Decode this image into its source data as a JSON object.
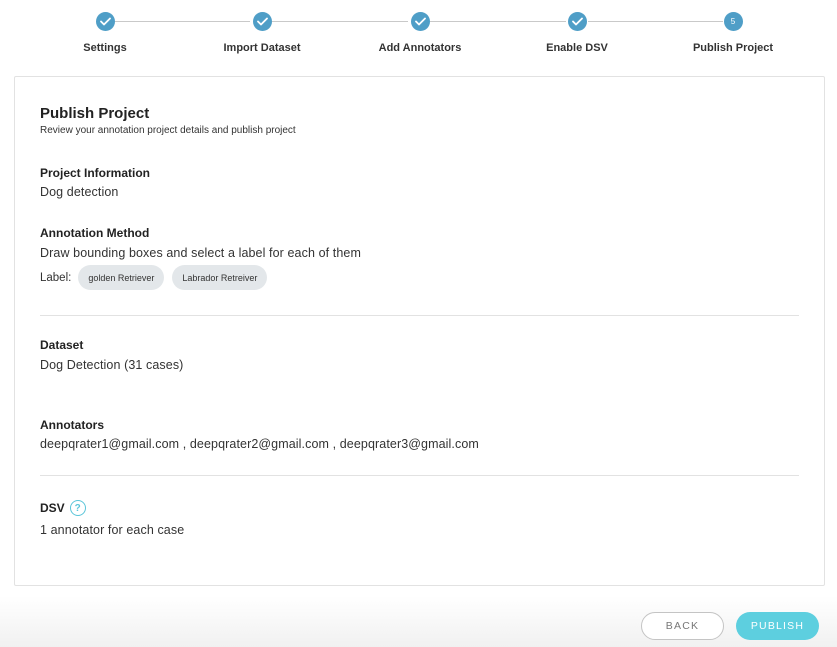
{
  "stepper": {
    "steps": [
      {
        "label": "Settings",
        "status": "completed"
      },
      {
        "label": "Import Dataset",
        "status": "completed"
      },
      {
        "label": "Add Annotators",
        "status": "completed"
      },
      {
        "label": "Enable DSV",
        "status": "completed"
      },
      {
        "label": "Publish Project",
        "status": "current",
        "number": "5"
      }
    ],
    "accent_color": "#4f9ec7"
  },
  "page": {
    "title": "Publish Project",
    "subtitle": "Review your annotation project details and publish project"
  },
  "project_information": {
    "title": "Project Information",
    "value": "Dog detection"
  },
  "annotation_method": {
    "title": "Annotation Method",
    "value": "Draw bounding boxes and select a label for each of them",
    "label_key": "Label:",
    "labels": [
      "golden Retriever",
      "Labrador Retreiver"
    ]
  },
  "dataset": {
    "title": "Dataset",
    "value": "Dog Detection (31 cases)"
  },
  "annotators": {
    "title": "Annotators",
    "value": "deepqrater1@gmail.com , deepqrater2@gmail.com , deepqrater3@gmail.com"
  },
  "dsv": {
    "title": "DSV",
    "help_icon": "question-circle-icon",
    "value": "1 annotator for each case"
  },
  "footer": {
    "back_label": "BACK",
    "publish_label": "PUBLISH",
    "publish_color": "#5dcfdf"
  }
}
